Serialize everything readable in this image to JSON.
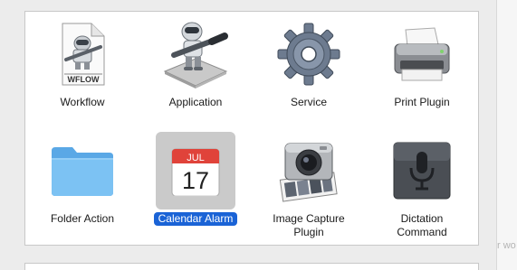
{
  "window": {
    "gutter_fragment": "r wo"
  },
  "templates": [
    {
      "id": "workflow",
      "label": "Workflow",
      "icon": "workflow-document-icon",
      "doc_text": "WFLOW"
    },
    {
      "id": "application",
      "label": "Application",
      "icon": "automator-robot-icon"
    },
    {
      "id": "service",
      "label": "Service",
      "icon": "gear-icon"
    },
    {
      "id": "print-plugin",
      "label": "Print Plugin",
      "icon": "printer-icon"
    },
    {
      "id": "folder-action",
      "label": "Folder Action",
      "icon": "folder-icon"
    },
    {
      "id": "calendar-alarm",
      "label": "Calendar Alarm",
      "icon": "calendar-icon",
      "month": "JUL",
      "day": "17",
      "selected": true
    },
    {
      "id": "image-capture-plugin",
      "label": "Image Capture\nPlugin",
      "icon": "camera-icon"
    },
    {
      "id": "dictation-command",
      "label": "Dictation\nCommand",
      "icon": "microphone-icon"
    }
  ],
  "colors": {
    "selection": "#1a63d6",
    "selected_icon_bg": "#cacaca",
    "calendar_red": "#e0433a"
  }
}
